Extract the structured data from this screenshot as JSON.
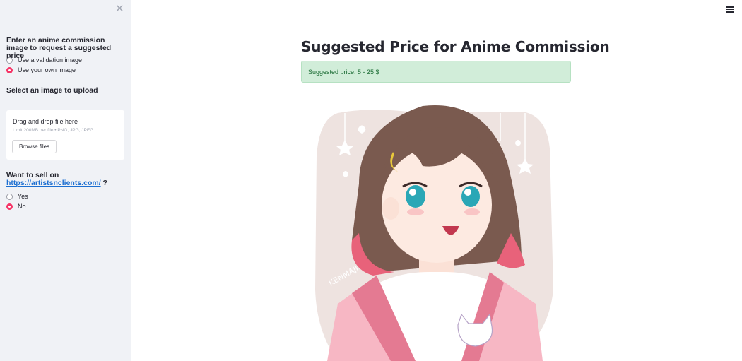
{
  "sidebar": {
    "close_symbol": "✕",
    "mode_heading": "Enter an anime commission image to request a suggested price",
    "mode_options": [
      {
        "label": "Use a validation image",
        "selected": false
      },
      {
        "label": "Use your own image",
        "selected": true
      }
    ],
    "upload_heading": "Select an image to upload",
    "uploader": {
      "title": "Drag and drop file here",
      "limit": "Limit 200MB per file • PNG, JPG, JPEG",
      "browse_label": "Browse files"
    },
    "sell": {
      "heading": "Want to sell on",
      "link_text": "https://artistsnclients.com/",
      "suffix": " ?",
      "options": [
        {
          "label": "Yes",
          "selected": false
        },
        {
          "label": "No",
          "selected": true
        }
      ]
    }
  },
  "main": {
    "title": "Suggested Price for Anime Commission",
    "result": "Suggested price: 5 - 25 $",
    "image_icon": "anime-girl-illustration",
    "image_signature": "KENMAJI"
  },
  "colors": {
    "accent": "#f63366",
    "sidebar_bg": "#f0f2f6",
    "success_bg": "#d1edd9",
    "success_text": "#1a6b33",
    "link": "#1c6fd1"
  },
  "icons": {
    "menu": "hamburger-menu-icon",
    "close": "close-icon"
  }
}
